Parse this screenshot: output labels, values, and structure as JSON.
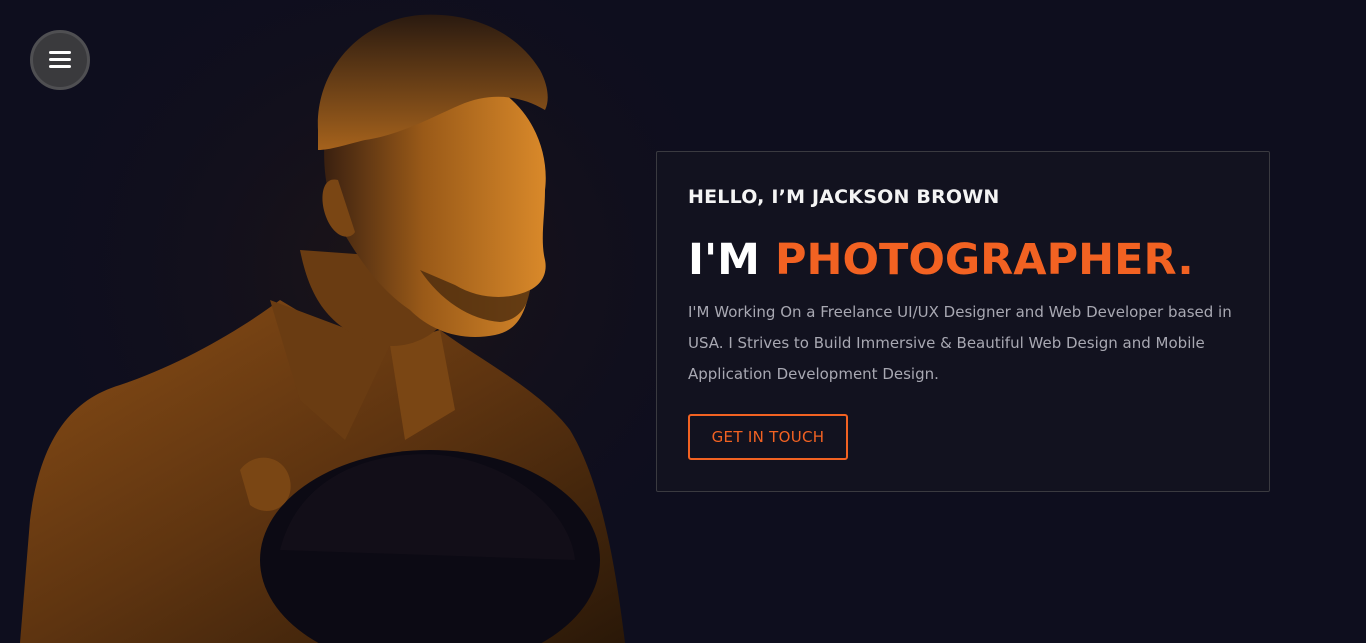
{
  "nav": {
    "menu_icon": "hamburger-menu-icon"
  },
  "hero": {
    "photo_subject": "portrait",
    "greeting": "HELLO, I’M JACKSON BROWN",
    "headline_prefix": "I'M ",
    "headline_role": "PHOTOGRAPHER.",
    "description": "I'M Working On a Freelance UI/UX Designer and Web Developer based in USA. I Strives to Build Immersive & Beautiful Web Design and Mobile Application Development Design.",
    "cta_label": "GET IN TOUCH"
  },
  "colors": {
    "background": "#0e0e1e",
    "accent": "#f26222",
    "text_primary": "#ffffff",
    "text_muted": "#a8a8b2",
    "card_border": "#3a3a40",
    "photo_tone": "#c8781f"
  }
}
